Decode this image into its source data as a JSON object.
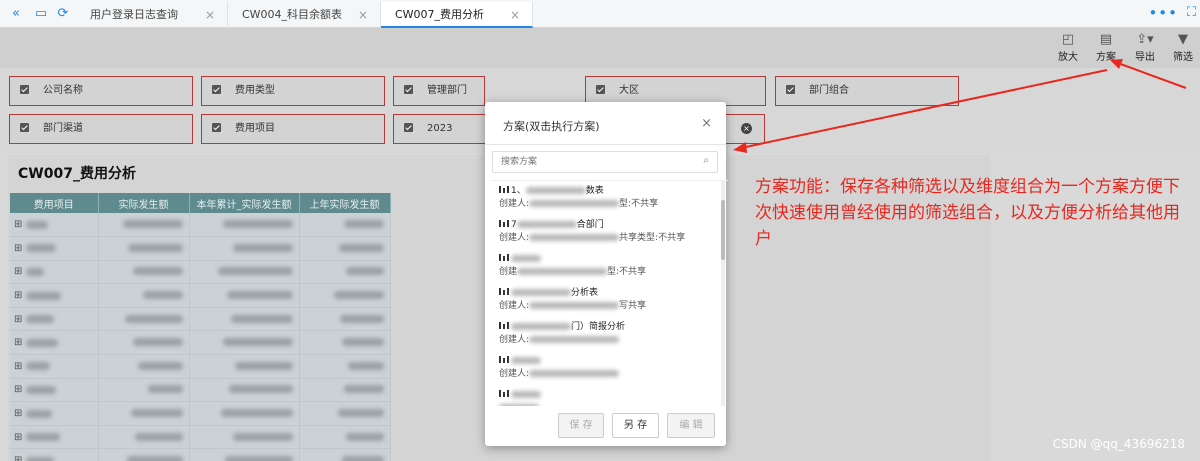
{
  "tabbar": {
    "tabs": [
      {
        "label": "用户登录日志查询",
        "active": false
      },
      {
        "label": "CW004_科目余额表",
        "active": false
      },
      {
        "label": "CW007_费用分析",
        "active": true
      }
    ],
    "close_glyph": "×",
    "more_glyph": "•••",
    "accent": "#1e88e5"
  },
  "toolbar": {
    "zoom_label": "放大",
    "scheme_label": "方案",
    "export_label": "导出",
    "filter_label": "筛选"
  },
  "filters": {
    "company": "公司名称",
    "expense_type": "费用类型",
    "mgmt_dept": "管理部门",
    "region": "大区",
    "dept_combo": "部门组合",
    "dept_channel": "部门渠道",
    "expense_item": "费用项目",
    "year_value": "2023"
  },
  "report": {
    "title": "CW007_费用分析",
    "columns": [
      "费用项目",
      "实际发生额",
      "本年累计_实际发生额",
      "上年实际发生额"
    ],
    "row_count": 11
  },
  "dialog": {
    "title": "方案(双击执行方案)",
    "close": "×",
    "search_placeholder": "搜索方案",
    "items": [
      {
        "line1_prefix": "1、",
        "line1_suffix": "数表",
        "line2_prefix": "创建人:",
        "line2_suffix": "型:不共享"
      },
      {
        "line1_prefix": "7",
        "line1_suffix": "合部门",
        "line2_prefix": "创建人:",
        "line2_suffix": "共享类型:不共享"
      },
      {
        "line1_prefix": "",
        "line1_suffix": "",
        "line2_prefix": "创建",
        "line2_suffix": "型:不共享"
      },
      {
        "line1_prefix": "",
        "line1_suffix": "分析表",
        "line2_prefix": "创建人:",
        "line2_suffix": "写共享"
      },
      {
        "line1_prefix": "",
        "line1_suffix": "门）简报分析",
        "line2_prefix": "创建人:",
        "line2_suffix": ""
      },
      {
        "line1_prefix": "",
        "line1_suffix": "",
        "line2_prefix": "创建人:",
        "line2_suffix": ""
      },
      {
        "line1_prefix": "",
        "line1_suffix": "",
        "line2_prefix": "",
        "line2_suffix": ""
      }
    ],
    "save_label": "保 存",
    "save_as_label": "另 存",
    "edit_label": "编 辑"
  },
  "annotation": {
    "text": "方案功能：保存各种筛选以及维度组合为一个方案方便下次快速使用曾经使用的筛选组合，以及方便分析给其他用户",
    "color": "#e8271f"
  },
  "watermark": "CSDN @qq_43696218"
}
